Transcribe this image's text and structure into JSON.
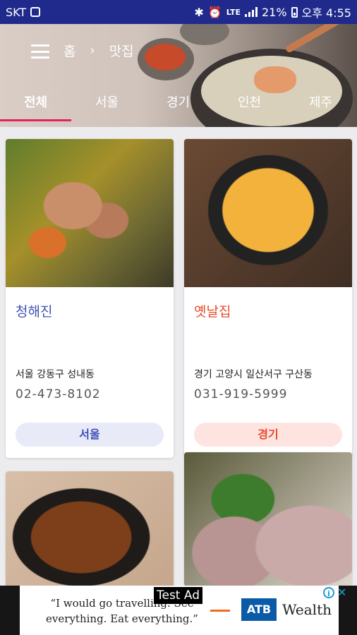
{
  "status_bar": {
    "carrier": "SKT",
    "battery_percent": "21%",
    "time": "오후 4:55",
    "network": "LTE"
  },
  "header": {
    "breadcrumb": [
      "홈",
      "맛집"
    ],
    "tabs": [
      "전체",
      "서울",
      "경기",
      "인천",
      "제주"
    ],
    "active_tab": "전체",
    "accent_color": "#e2245a"
  },
  "cards": [
    {
      "name": "청해진",
      "address": "서울 강동구 성내동",
      "phone": "02-473-8102",
      "region": "서울",
      "name_color": "#3f51b5",
      "chip_bg": "#e8eaf8",
      "chip_color": "#3f51b5"
    },
    {
      "name": "옛날집",
      "address": "경기 고양시 일산서구 구산동",
      "phone": "031-919-5999",
      "region": "경기",
      "name_color": "#e84c2b",
      "chip_bg": "#fde4e1",
      "chip_color": "#e84c2b"
    }
  ],
  "ad": {
    "label": "Test Ad",
    "quote": "“I would go travelling. See everything. Eat everything.”",
    "brand": "ATB",
    "brand_suffix": "Wealth"
  }
}
